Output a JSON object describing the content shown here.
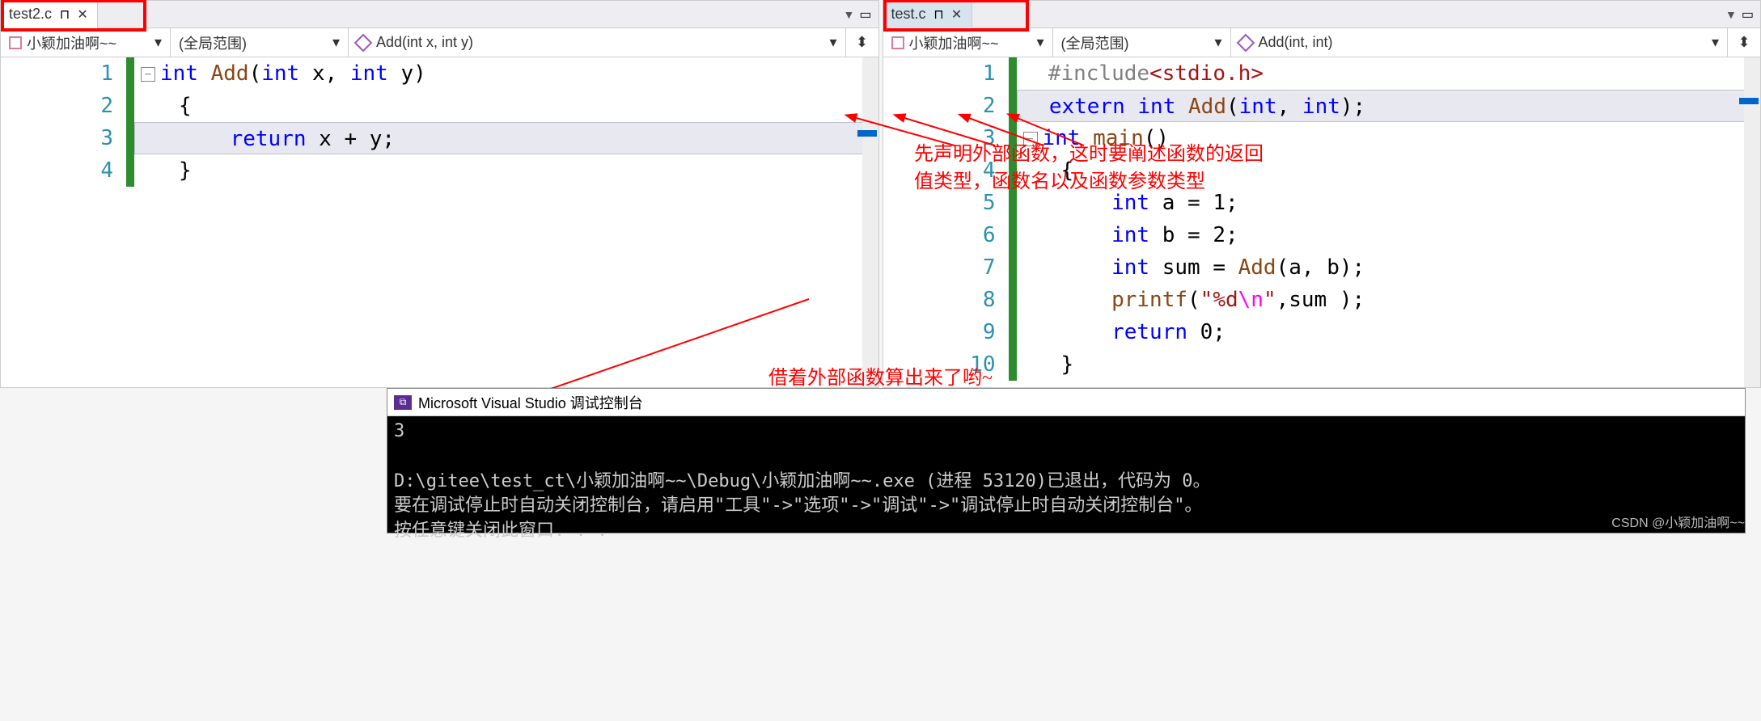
{
  "left_pane": {
    "tab": {
      "filename": "test2.c"
    },
    "nav": {
      "project": "小颖加油啊~~",
      "scope": "(全局范围)",
      "func": "Add(int x, int y)"
    },
    "lines": [
      "1",
      "2",
      "3",
      "4"
    ],
    "code": {
      "l1_kw": "int",
      "l1_fn": "Add",
      "l1_p1": "int",
      "l1_v1": "x",
      "l1_p2": "int",
      "l1_v2": "y",
      "l2": "{",
      "l3_kw": "return",
      "l3_expr": "x + y;",
      "l4": "}"
    }
  },
  "right_pane": {
    "tab": {
      "filename": "test.c"
    },
    "nav": {
      "project": "小颖加油啊~~",
      "scope": "(全局范围)",
      "func": "Add(int, int)"
    },
    "lines": [
      "1",
      "2",
      "3",
      "4",
      "5",
      "6",
      "7",
      "8",
      "9",
      "10"
    ],
    "code": {
      "l1_inc": "#include",
      "l1_path": "<stdio.h>",
      "l2_ext": "extern",
      "l2_int": "int",
      "l2_fn": "Add",
      "l2_t1": "int",
      "l2_t2": "int",
      "l3_int": "int",
      "l3_main": "main",
      "l4": "{",
      "l5_int": "int",
      "l5_rest": " a = 1;",
      "l6_int": "int",
      "l6_rest": " b = 2;",
      "l7_int": "int",
      "l7_rest": " sum = ",
      "l7_fn": "Add",
      "l7_args": "(a, b);",
      "l8_fn": "printf",
      "l8_q": "\"",
      "l8_fmt": "%d",
      "l8_esc": "\\n",
      "l8_rest": ",sum );",
      "l9_ret": "return",
      "l9_val": " 0;",
      "l10": "}"
    }
  },
  "annotations": {
    "note1_l1": "先声明外部函数，这时要阐述函数的返回",
    "note1_l2": "值类型，函数名以及函数参数类型",
    "note2": "借着外部函数算出来了哟~"
  },
  "console": {
    "title": "Microsoft Visual Studio 调试控制台",
    "output_1": "3",
    "output_2": "D:\\gitee\\test_ct\\小颖加油啊~~\\Debug\\小颖加油啊~~.exe (进程 53120)已退出，代码为 0。",
    "output_3": "要在调试停止时自动关闭控制台，请启用\"工具\"->\"选项\"->\"调试\"->\"调试停止时自动关闭控制台\"。",
    "output_4": "按任意键关闭此窗口. . ."
  },
  "watermark": "CSDN @小颖加油啊~~"
}
